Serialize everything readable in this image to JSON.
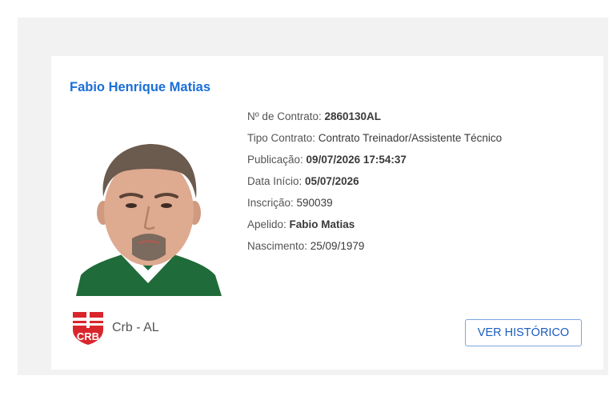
{
  "person": {
    "name": "Fabio Henrique Matias",
    "photo_alt": "Fabio Henrique Matias"
  },
  "details": [
    {
      "label": "Nº de Contrato: ",
      "value": "2860130AL",
      "bold": true
    },
    {
      "label": "Tipo Contrato: ",
      "value": "Contrato Treinador/Assistente Técnico",
      "bold": false
    },
    {
      "label": "Publicação: ",
      "value": "09/07/2026 17:54:37",
      "bold": true
    },
    {
      "label": "Data Início: ",
      "value": "05/07/2026",
      "bold": true
    },
    {
      "label": "Inscrição: ",
      "value": "590039",
      "bold": false
    },
    {
      "label": "Apelido: ",
      "value": "Fabio Matias",
      "bold": true
    },
    {
      "label": "Nascimento: ",
      "value": "25/09/1979",
      "bold": false
    }
  ],
  "club": {
    "crest_icon": "crb-crest-icon",
    "name": "Crb - AL",
    "crest_colors": {
      "primary": "#d9262c",
      "secondary": "#ffffff"
    }
  },
  "actions": {
    "history_label": "VER HISTÓRICO"
  },
  "colors": {
    "name": "#1a6ed8",
    "button_border": "#7ba7e0",
    "button_text": "#1a5cc0",
    "shirt": "#1f6b3a"
  }
}
